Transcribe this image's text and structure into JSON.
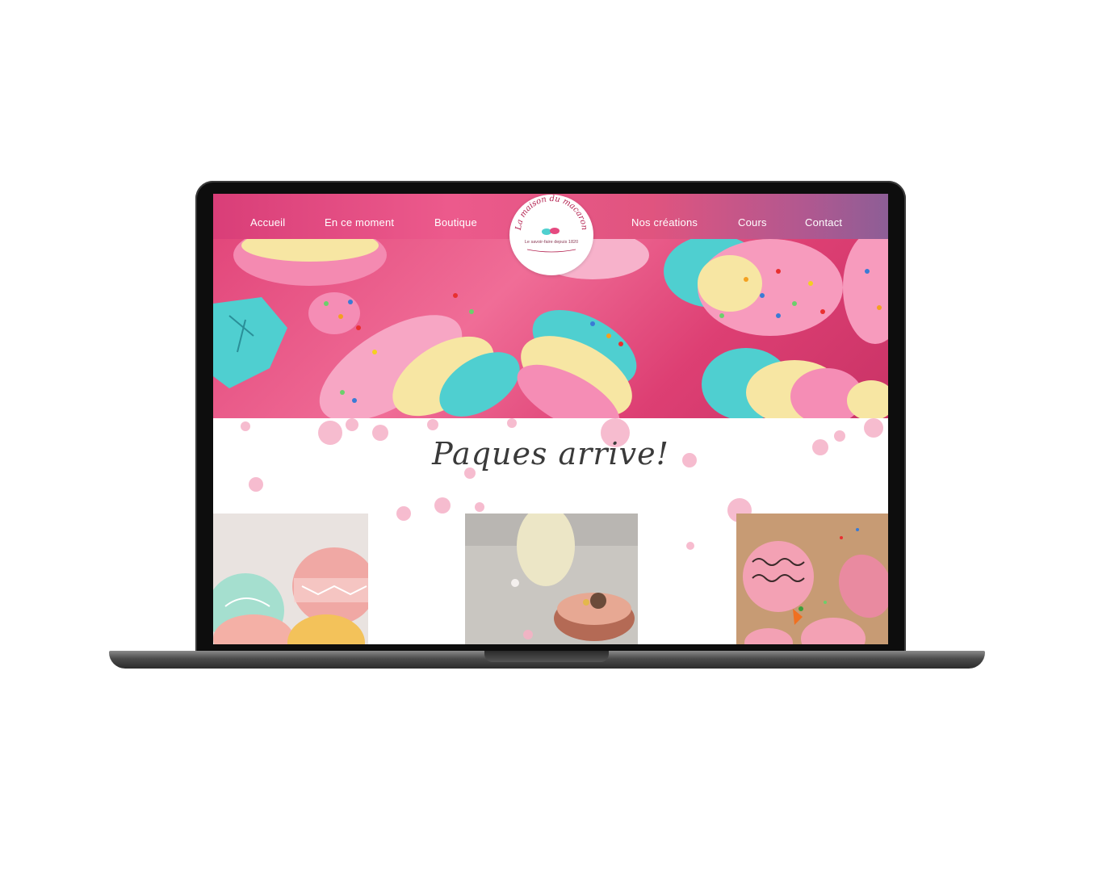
{
  "nav": {
    "left": [
      "Accueil",
      "En ce moment",
      "Boutique"
    ],
    "right": [
      "Nos créations",
      "Cours",
      "Contact"
    ]
  },
  "logo": {
    "name": "La maison du macaron",
    "tagline": "Le savoir-faire depuis 1820"
  },
  "section": {
    "title": "Paques arrive!"
  },
  "colors": {
    "brand_pink": "#e54a80",
    "accent_turquoise": "#4fd0cf",
    "cream": "#f7e6a3"
  },
  "cards": [
    {
      "icon": "decorated-easter-eggs-photo"
    },
    {
      "icon": "bunny-macaron-photo"
    },
    {
      "icon": "easter-egg-macarons-photo"
    }
  ]
}
